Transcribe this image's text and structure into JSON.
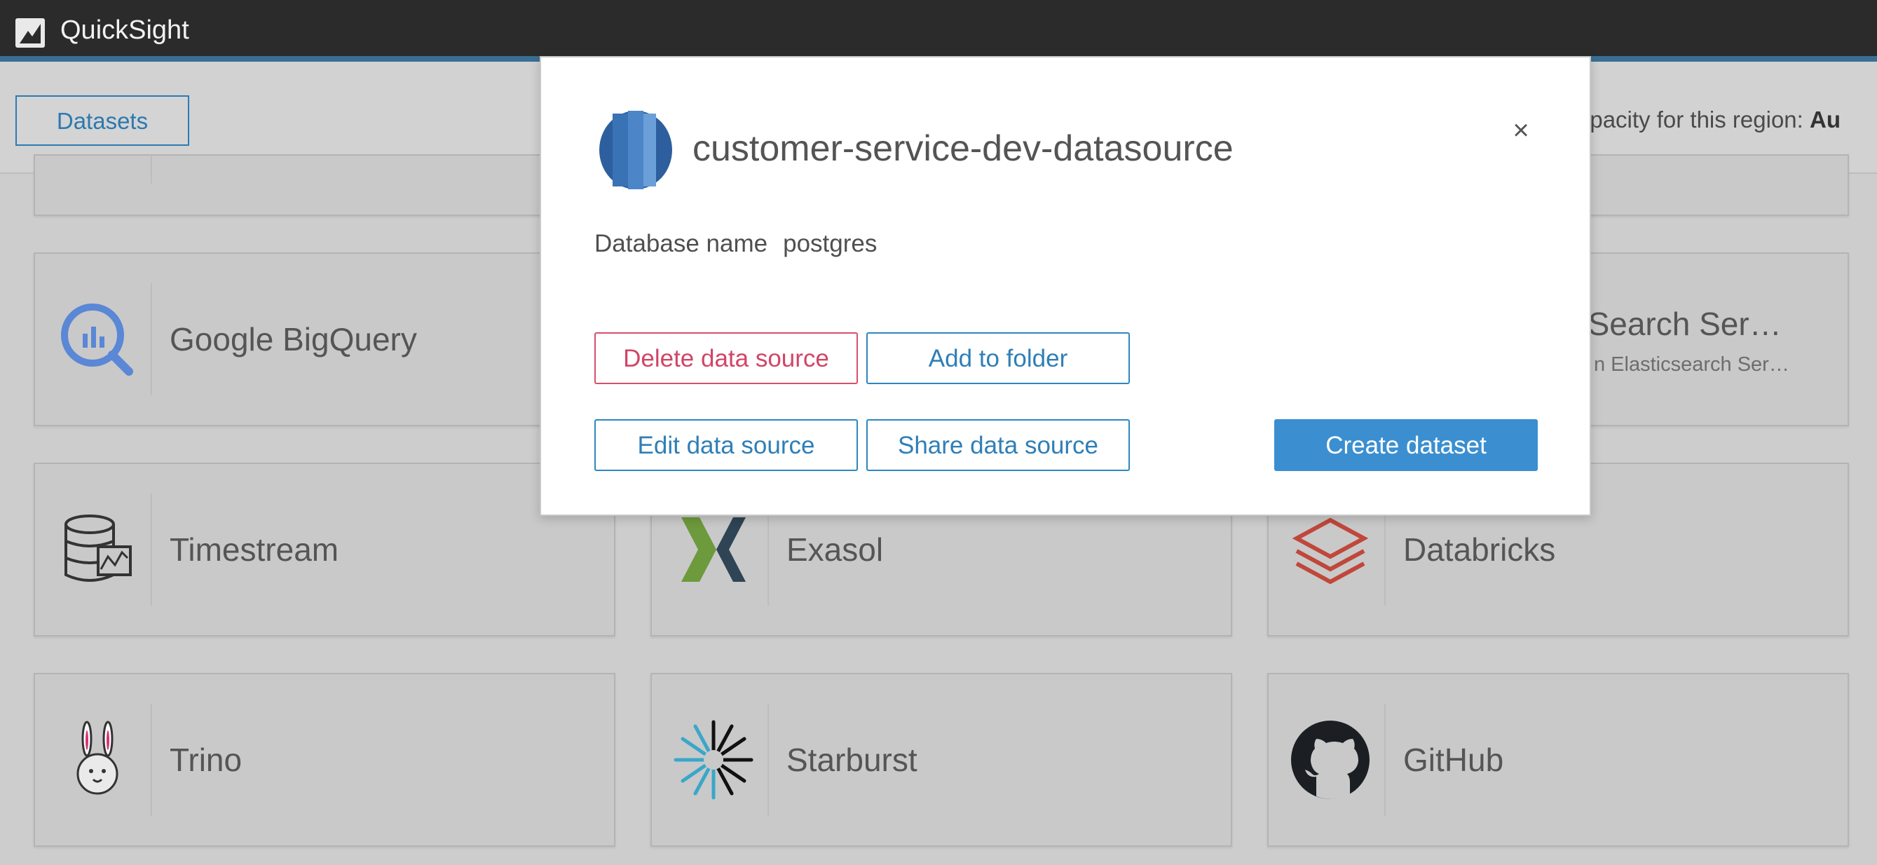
{
  "app": {
    "title": "QuickSight"
  },
  "subbar": {
    "datasets_label": "Datasets",
    "capacity_text": "apacity for this region: ",
    "capacity_value": "Au"
  },
  "cards": [
    {
      "label": "Google BigQuery",
      "icon": "bigquery-icon"
    },
    {
      "label": "nSearch Ser…",
      "sublabel": "n Elasticsearch Ser…",
      "icon": "opensearch-icon"
    },
    {
      "label": "Timestream",
      "icon": "timestream-icon"
    },
    {
      "label": "Exasol",
      "icon": "exasol-icon"
    },
    {
      "label": "Databricks",
      "icon": "databricks-icon"
    },
    {
      "label": "Trino",
      "icon": "trino-icon"
    },
    {
      "label": "Starburst",
      "icon": "starburst-icon"
    },
    {
      "label": "GitHub",
      "icon": "github-icon"
    }
  ],
  "modal": {
    "title": "customer-service-dev-datasource",
    "db_label": "Database name",
    "db_value": "postgres",
    "close_glyph": "×",
    "buttons": {
      "delete": "Delete data source",
      "add_folder": "Add to folder",
      "edit": "Edit data source",
      "share": "Share data source",
      "create": "Create dataset"
    }
  },
  "colors": {
    "accent": "#2c7bb6",
    "primary_button": "#3b8fd0",
    "danger": "#d14566",
    "topbar": "#2b2b2b"
  }
}
